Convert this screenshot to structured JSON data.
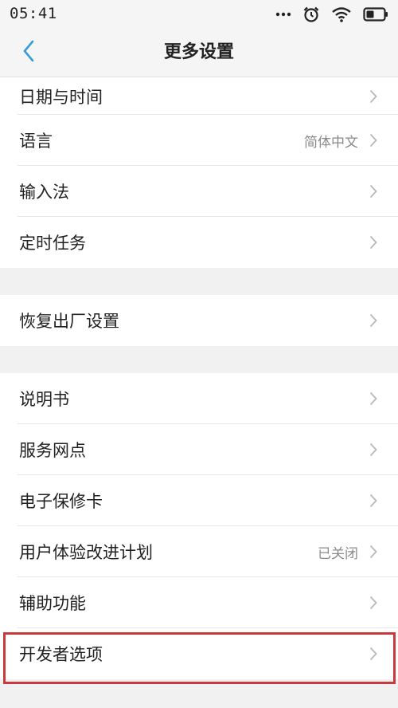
{
  "status": {
    "time": "05:41",
    "icons": [
      "more-dots-icon",
      "alarm-icon",
      "wifi-icon",
      "battery-icon"
    ]
  },
  "header": {
    "title": "更多设置",
    "back_icon": "chevron-left-icon"
  },
  "groups": [
    {
      "items": [
        {
          "label": "日期与时间",
          "value": ""
        },
        {
          "label": "语言",
          "value": "简体中文"
        },
        {
          "label": "输入法",
          "value": ""
        },
        {
          "label": "定时任务",
          "value": ""
        }
      ]
    },
    {
      "items": [
        {
          "label": "恢复出厂设置",
          "value": ""
        }
      ]
    },
    {
      "items": [
        {
          "label": "说明书",
          "value": ""
        },
        {
          "label": "服务网点",
          "value": ""
        },
        {
          "label": "电子保修卡",
          "value": ""
        },
        {
          "label": "用户体验改进计划",
          "value": "已关闭"
        },
        {
          "label": "辅助功能",
          "value": ""
        },
        {
          "label": "开发者选项",
          "value": ""
        }
      ]
    }
  ],
  "colors": {
    "accent": "#3a9bd9",
    "highlight": "#c93a3f",
    "value_text": "#8a8a8a",
    "chevron": "#b8b8b8"
  }
}
